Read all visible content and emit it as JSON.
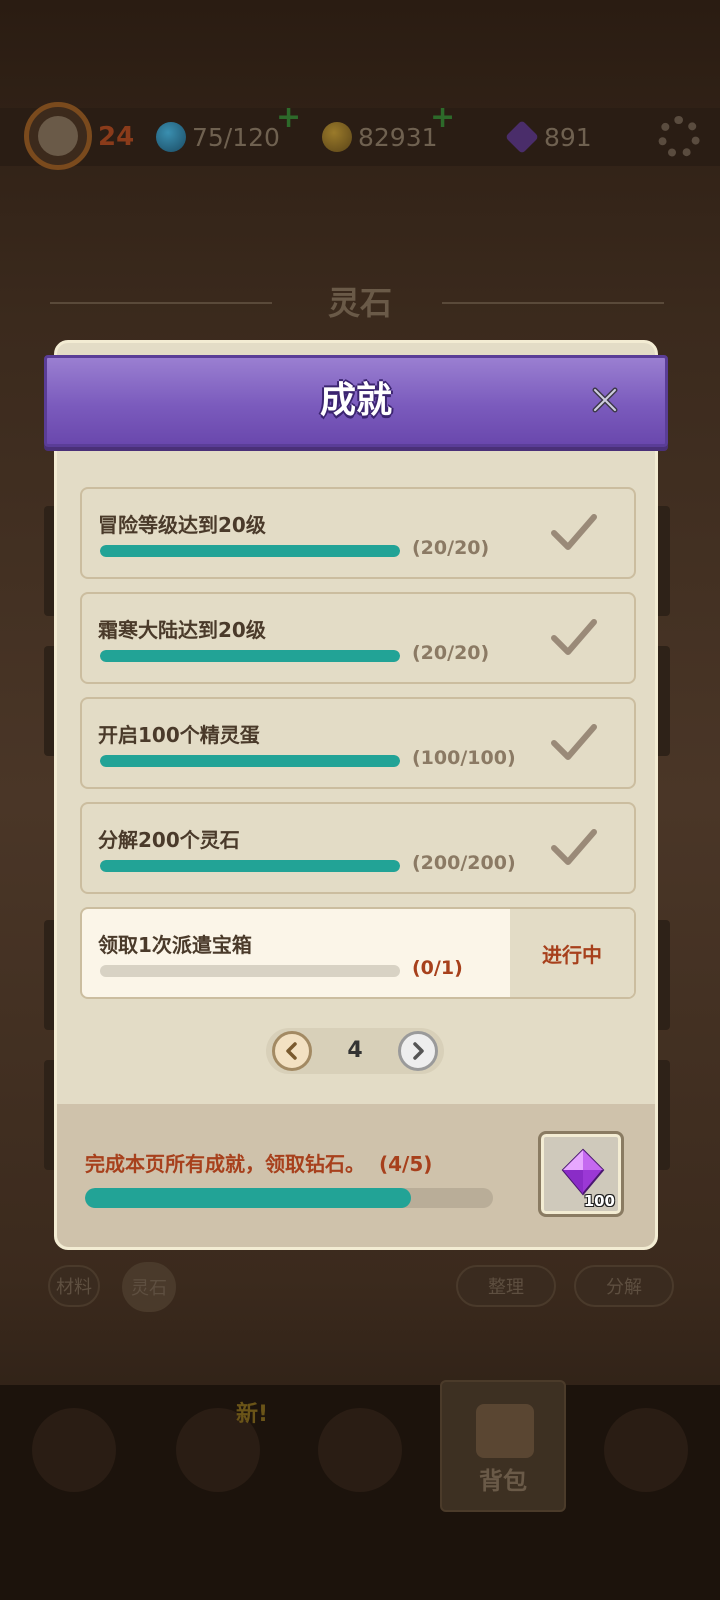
{
  "topbar": {
    "level": "24",
    "stamina": "75/120",
    "gold": "82931",
    "gems": "891"
  },
  "background": {
    "section_title": "灵石",
    "tabs": [
      "材料",
      "灵石"
    ],
    "actions": [
      "整理",
      "分解"
    ],
    "new_badge": "新!",
    "nav_active_label": "背包"
  },
  "modal": {
    "title": "成就",
    "achievements": [
      {
        "name": "冒险等级达到20级",
        "count": "(20/20)",
        "progress": 1.0,
        "completed": true
      },
      {
        "name": "霜寒大陆达到20级",
        "count": "(20/20)",
        "progress": 1.0,
        "completed": true
      },
      {
        "name": "开启100个精灵蛋",
        "count": "(100/100)",
        "progress": 1.0,
        "completed": true
      },
      {
        "name": "分解200个灵石",
        "count": "(200/200)",
        "progress": 1.0,
        "completed": true
      },
      {
        "name": "领取1次派遣宝箱",
        "count": "(0/1)",
        "progress": 0.0,
        "completed": false,
        "status": "进行中"
      }
    ],
    "page": "4",
    "reward": {
      "text": "完成本页所有成就，领取钻石。",
      "count": "(4/5)",
      "progress": 0.8,
      "quantity": "100",
      "icon": "purple-gem-icon"
    }
  },
  "colors": {
    "progress_fill": "#22a396",
    "accent_text": "#a7401c",
    "header_purple": "#7b5bbd"
  }
}
